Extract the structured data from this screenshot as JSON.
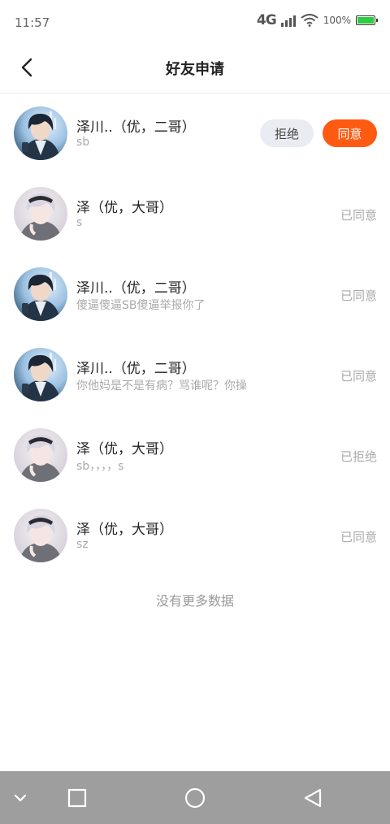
{
  "status": {
    "time": "11:57",
    "network": "4G",
    "battery": "100%"
  },
  "nav": {
    "title": "好友申请"
  },
  "requests": [
    {
      "name": "泽川..（优，二哥）",
      "message": "sb",
      "reject_label": "拒绝",
      "agree_label": "同意",
      "avatar": "dark-haired-boy"
    },
    {
      "name": "泽（优，大哥）",
      "message": "s",
      "status": "已同意",
      "avatar": "silver-haired-boy"
    },
    {
      "name": "泽川..（优，二哥）",
      "message": "傻逼傻逼SB傻逼举报你了",
      "status": "已同意",
      "avatar": "dark-haired-boy"
    },
    {
      "name": "泽川..（优，二哥）",
      "message": "你他妈是不是有病？骂谁呢？你操",
      "status": "已同意",
      "avatar": "dark-haired-boy"
    },
    {
      "name": "泽（优，大哥）",
      "message": "sb，，，，s",
      "status": "已拒绝",
      "avatar": "silver-haired-boy"
    },
    {
      "name": "泽（优，大哥）",
      "message": "sz",
      "status": "已同意",
      "avatar": "silver-haired-boy"
    }
  ],
  "footer": {
    "no_more": "没有更多数据"
  },
  "colors": {
    "accent": "#ff5a12",
    "reject_bg": "#e9ecf2",
    "status_gray": "#aaaaaa",
    "sysnav_bg": "#9e9e9e"
  }
}
